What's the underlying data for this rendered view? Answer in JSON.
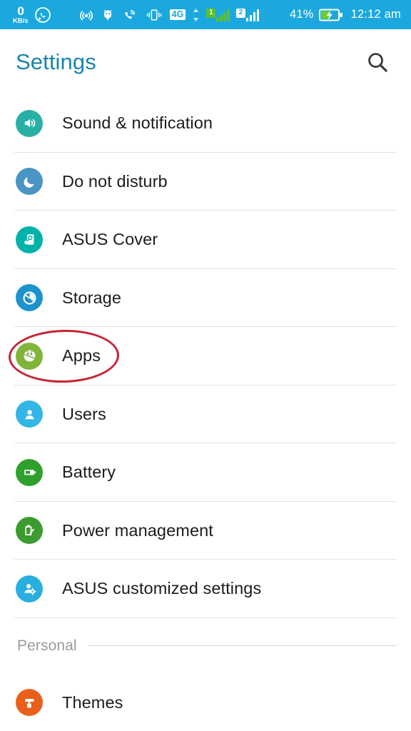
{
  "statusbar": {
    "background": "#1BA8DE",
    "network_speed_value": "0",
    "network_speed_unit": "KB/s",
    "icons": [
      "whatsapp-icon",
      "hotspot-icon",
      "usb-debug-icon",
      "missed-call-icon",
      "vibrate-icon"
    ],
    "network_type": "4G",
    "sim1_label": "1",
    "sim2_label": "2",
    "battery_percent": "41%",
    "battery_state": "charging",
    "clock": "12:12 am"
  },
  "header": {
    "title": "Settings",
    "title_color": "#1B84AE",
    "search_icon": "search-icon"
  },
  "list": [
    {
      "label": "Sound & notification",
      "icon": "speaker-icon",
      "icon_color": "#29B0A6"
    },
    {
      "label": "Do not disturb",
      "icon": "moon-icon",
      "icon_color": "#4A94C6"
    },
    {
      "label": "ASUS Cover",
      "icon": "cover-icon",
      "icon_color": "#00B2A9"
    },
    {
      "label": "Storage",
      "icon": "storage-disk-icon",
      "icon_color": "#1D92CF"
    },
    {
      "label": "Apps",
      "icon": "android-robot-icon",
      "icon_color": "#7FB539",
      "annotated": true
    },
    {
      "label": "Users",
      "icon": "person-icon",
      "icon_color": "#33B5E5"
    },
    {
      "label": "Battery",
      "icon": "battery-icon",
      "icon_color": "#2EA02E"
    },
    {
      "label": "Power management",
      "icon": "battery-leaf-icon",
      "icon_color": "#3B9B2F"
    },
    {
      "label": "ASUS customized settings",
      "icon": "person-gear-icon",
      "icon_color": "#29AEE0"
    }
  ],
  "section": {
    "label": "Personal"
  },
  "personal_list": [
    {
      "label": "Themes",
      "icon": "paint-roller-icon",
      "icon_color": "#E8601C"
    }
  ],
  "annotation": {
    "shape": "ellipse",
    "color": "#C62433",
    "target": "Apps"
  }
}
